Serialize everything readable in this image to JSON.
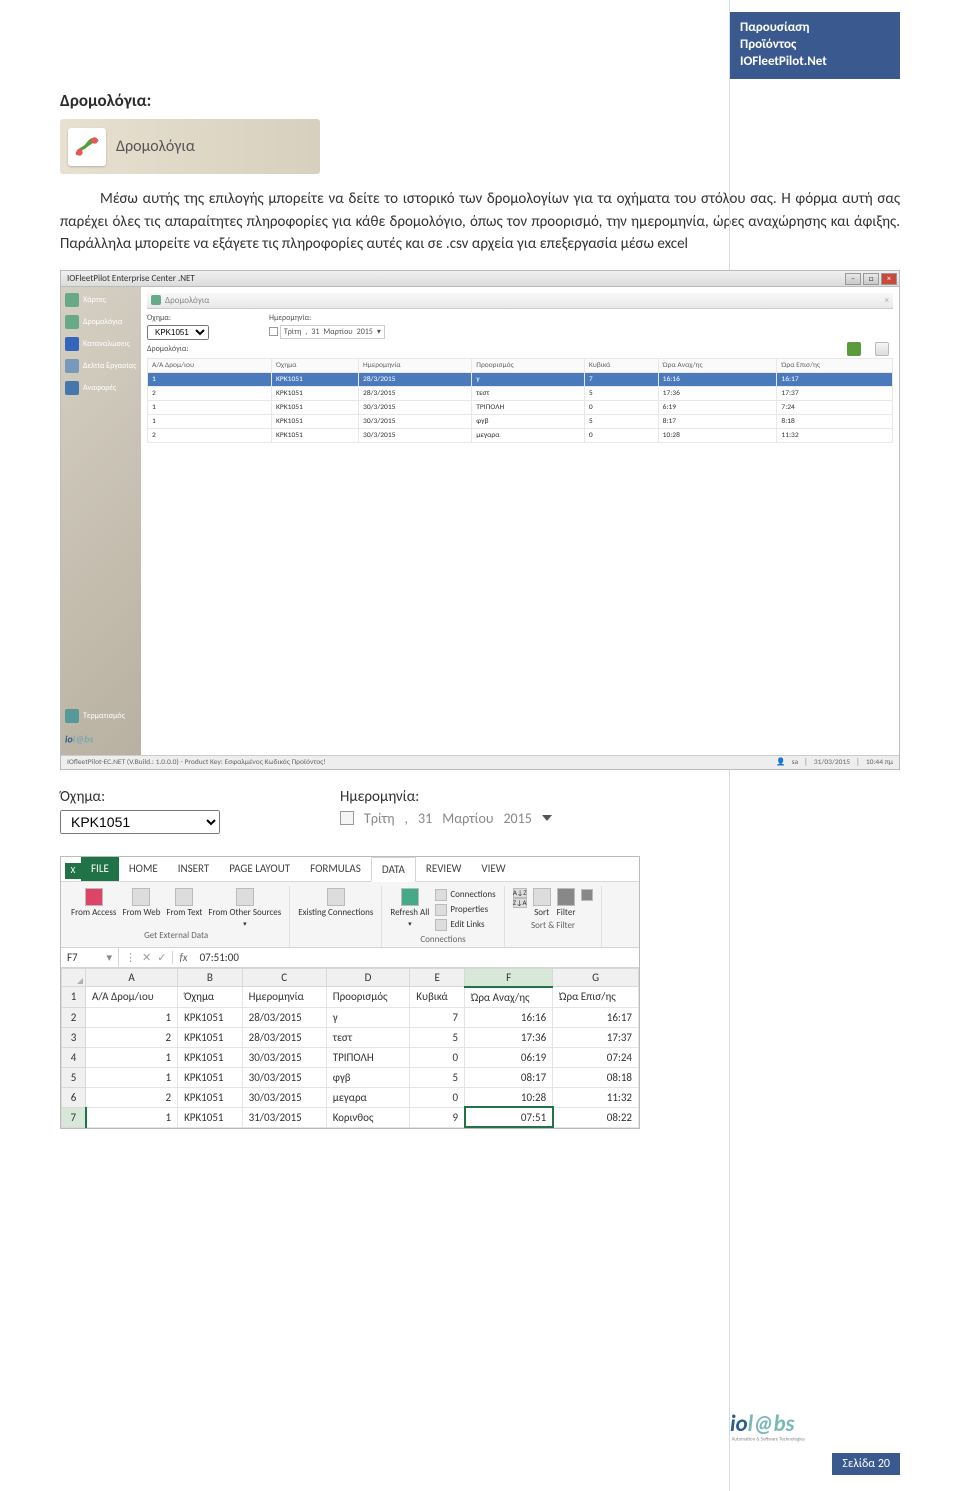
{
  "header": {
    "line1": "Παρουσίαση",
    "line2": "Προϊόντος",
    "line3": "IOFleetPilot.Net"
  },
  "section_title": "Δρομολόγια:",
  "toolbar_label": "Δρομολόγια",
  "paragraph": "Μέσω αυτής της επιλογής μπορείτε να δείτε το ιστορικό των δρομολογίων για τα οχήματα του στόλου σας. Η φόρμα αυτή σας παρέχει όλες τις απαραίτητες πληροφορίες για κάθε δρομολόγιο, όπως τον προορισμό, την ημερομηνία, ώρες αναχώρησης και άφιξης. Παράλληλα μπορείτε να εξάγετε τις πληροφορίες αυτές και σε .csv αρχεία για επεξεργασία μέσω excel",
  "app1": {
    "title": "IOFleetPilot Enterprise Center .NET",
    "tab_header": "Δρομολόγια",
    "sidebar": [
      {
        "label": "Χάρτες"
      },
      {
        "label": "Δρομολόγια"
      },
      {
        "label": "Καταναλώσεις"
      },
      {
        "label": "Δελτία Εργασίας"
      },
      {
        "label": "Αναφορές"
      }
    ],
    "sidebar_terminate": "Τερματισμός",
    "filters": {
      "vehicle_label": "Όχημα:",
      "vehicle_value": "KPK1051",
      "date_label": "Ημερομηνία:",
      "date_parts": {
        "day": "Τρίτη",
        "num": "31",
        "month": "Μαρτίου",
        "year": "2015"
      }
    },
    "subtext": "Δρομολόγια:",
    "table": {
      "headers": [
        "Α/Α Δρομ/ιου",
        "Όχημα",
        "Ημερομηνία",
        "Προορισμός",
        "Κυβικά",
        "Ώρα Αναχ/ης",
        "Ώρα Επισ/ης"
      ],
      "rows": [
        [
          "1",
          "KPK1051",
          "28/3/2015",
          "γ",
          "7",
          "16:16",
          "16:17"
        ],
        [
          "2",
          "KPK1051",
          "28/3/2015",
          "τεστ",
          "5",
          "17:36",
          "17:37"
        ],
        [
          "1",
          "KPK1051",
          "30/3/2015",
          "ΤΡΙΠΟΛΗ",
          "0",
          "6:19",
          "7:24"
        ],
        [
          "1",
          "KPK1051",
          "30/3/2015",
          "φγβ",
          "5",
          "8:17",
          "8:18"
        ],
        [
          "2",
          "KPK1051",
          "30/3/2015",
          "μεγαρα",
          "0",
          "10:28",
          "11:32"
        ]
      ]
    },
    "statusbar": {
      "left": "IOfleetPilot-EC.NET (V.Build.: 1.0.0.0) - Product Key: Εσφαλμένος Κωδικός Προϊόντος!",
      "user": "sa",
      "date": "31/03/2015",
      "time": "10:44 πμ"
    }
  },
  "closeup": {
    "vehicle_label": "Όχημα:",
    "vehicle_value": "KPK1051",
    "date_label": "Ημερομηνία:",
    "date_day": "Τρίτη",
    "date_sep": ",",
    "date_num": "31",
    "date_month": "Μαρτίου",
    "date_year": "2015"
  },
  "excel": {
    "tabs": [
      "FILE",
      "HOME",
      "INSERT",
      "PAGE LAYOUT",
      "FORMULAS",
      "DATA",
      "REVIEW",
      "VIEW"
    ],
    "ribbon": {
      "group1": {
        "label": "Get External Data",
        "btns": [
          "From Access",
          "From Web",
          "From Text",
          "From Other Sources"
        ]
      },
      "group2": {
        "label": "",
        "btns": [
          "Existing Connections"
        ]
      },
      "group3": {
        "label": "Connections",
        "main": "Refresh All",
        "side": [
          "Connections",
          "Properties",
          "Edit Links"
        ]
      },
      "group4": {
        "label": "Sort & Filter",
        "btns": [
          "Sort",
          "Filter"
        ]
      }
    },
    "namebox": "F7",
    "formula_value": "07:51:00",
    "cols": [
      "A",
      "B",
      "C",
      "D",
      "E",
      "F",
      "G"
    ],
    "header_row": [
      "Α/Α Δρομ/ιου",
      "Όχημα",
      "Ημερομηνία",
      "Προορισμός",
      "Κυβικά",
      "Ώρα Αναχ/ης",
      "Ώρα Επισ/ης"
    ],
    "rows": [
      [
        "1",
        "KPK1051",
        "28/03/2015",
        "γ",
        "7",
        "16:16",
        "16:17"
      ],
      [
        "2",
        "KPK1051",
        "28/03/2015",
        "τεστ",
        "5",
        "17:36",
        "17:37"
      ],
      [
        "1",
        "KPK1051",
        "30/03/2015",
        "ΤΡΙΠΟΛΗ",
        "0",
        "06:19",
        "07:24"
      ],
      [
        "1",
        "KPK1051",
        "30/03/2015",
        "φγβ",
        "5",
        "08:17",
        "08:18"
      ],
      [
        "2",
        "KPK1051",
        "30/03/2015",
        "μεγαρα",
        "0",
        "10:28",
        "11:32"
      ],
      [
        "1",
        "KPK1051",
        "31/03/2015",
        "Κορινθος",
        "9",
        "07:51",
        "08:22"
      ]
    ],
    "selected_cell": {
      "row": 6,
      "col": 5
    }
  },
  "footer": {
    "page_label": "Σελίδα 20",
    "logo_text": "iol@bs",
    "logo_sub": "Automation & Software Technologies"
  }
}
